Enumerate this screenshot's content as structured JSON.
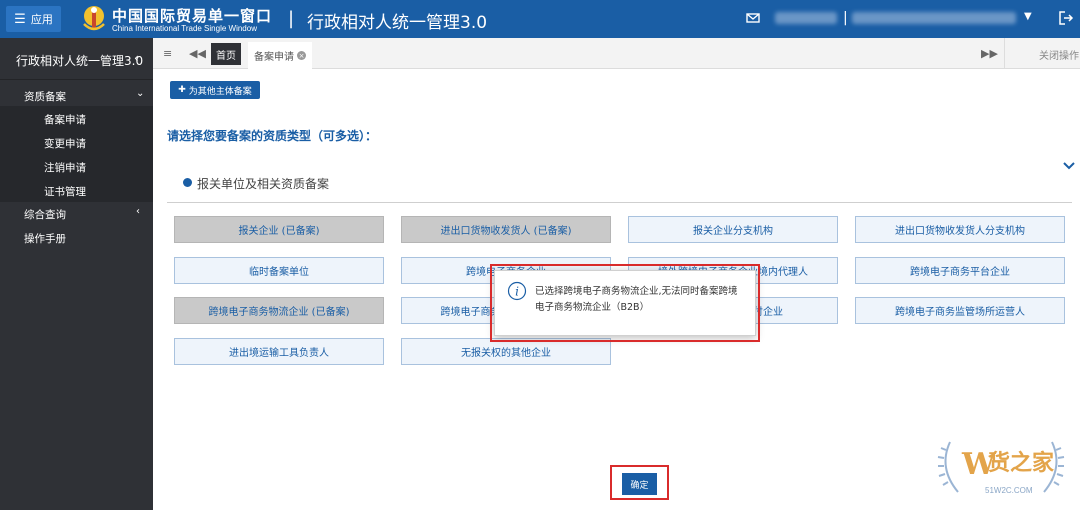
{
  "header": {
    "menu_label": "应用",
    "brand_zh": "中国国际贸易单一窗口",
    "brand_en": "China International Trade Single Window",
    "separator": "|",
    "system_title": "行政相对人统一管理3.0",
    "mail_icon": "mail-icon",
    "logout_icon": "logout-icon"
  },
  "sidebar": {
    "title": "行政相对人统一管理3.0",
    "groups": [
      {
        "label": "资质备案",
        "sub": [
          "备案申请",
          "变更申请",
          "注销申请",
          "证书管理"
        ]
      },
      {
        "label": "综合查询"
      },
      {
        "label": "操作手册"
      }
    ]
  },
  "tabs": {
    "home": "首页",
    "active": "备案申请",
    "close_ops": "关闭操作"
  },
  "content": {
    "other_button": "为其他主体备案",
    "prompt": "请选择您要备案的资质类型（可多选）：",
    "section": "报关单位及相关资质备案",
    "options": [
      {
        "label": "报关企业 (已备案)",
        "filed": true
      },
      {
        "label": "进出口货物收发货人 (已备案)",
        "filed": true
      },
      {
        "label": "报关企业分支机构",
        "filed": false
      },
      {
        "label": "进出口货物收发货人分支机构",
        "filed": false
      },
      {
        "label": "临时备案单位",
        "filed": false
      },
      {
        "label": "跨境电子商务企业",
        "filed": false
      },
      {
        "label": "境外跨境电子商务企业境内代理人",
        "filed": false
      },
      {
        "label": "跨境电子商务平台企业",
        "filed": false
      },
      {
        "label": "跨境电子商务物流企业 (已备案)",
        "filed": true
      },
      {
        "label": "跨境电子商务物流企业 (B2B)",
        "filed": false
      },
      {
        "label": "跨境电子商务支付企业",
        "filed": false
      },
      {
        "label": "跨境电子商务监管场所运营人",
        "filed": false
      },
      {
        "label": "进出境运输工具负责人",
        "filed": false
      },
      {
        "label": "无报关权的其他企业",
        "filed": false
      }
    ],
    "confirm": "确定"
  },
  "popup": {
    "message": "已选择跨境电子商务物流企业,无法同时备案跨境电子商务物流企业（B2B）"
  },
  "watermark": {
    "text": "货之家",
    "sub": "51W2C.COM"
  },
  "colors": {
    "primary": "#1a5ea5",
    "sidebar": "#2f3136",
    "highlight": "#d92b2b"
  }
}
